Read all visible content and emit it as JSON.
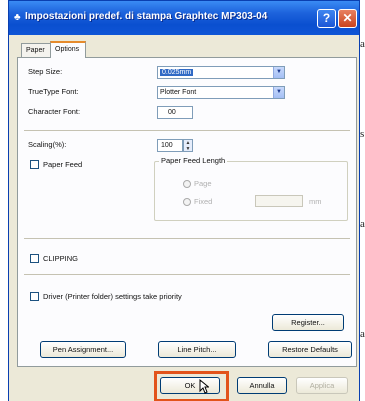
{
  "window": {
    "title": "Impostazioni predef. di stampa Graphtec MP303-04",
    "help_glyph": "?",
    "close_glyph": "✕"
  },
  "tabs": [
    {
      "label": "Paper",
      "active": false
    },
    {
      "label": "Options",
      "active": true
    }
  ],
  "options": {
    "step_size": {
      "label": "Step Size:",
      "value": "0.025mm"
    },
    "truetype_font": {
      "label": "TrueType Font:",
      "value": "Plotter Font"
    },
    "character_font": {
      "label": "Character Font:",
      "value": "00"
    },
    "scaling": {
      "label": "Scaling(%):",
      "value": "100"
    },
    "paper_feed": {
      "label": "Paper Feed",
      "checked": false
    },
    "paper_feed_length": {
      "group_label": "Paper Feed Length",
      "radio1_label": "Page",
      "radio2_label": "Fixed",
      "length_suffix": "mm"
    },
    "clipping": {
      "label": "CLIPPING",
      "checked": false
    },
    "driver_priority": {
      "label": "Driver (Printer folder) settings take priority",
      "checked": false
    }
  },
  "buttons": {
    "register": "Register...",
    "pen_assignment": "Pen Assignment...",
    "line_pitch": "Line Pitch...",
    "restore_defaults": "Restore Defaults",
    "ok": "OK",
    "annulla": "Annulla",
    "applica": "Applica"
  },
  "margin_letters": [
    "a",
    "s",
    "a",
    "a"
  ],
  "colors": {
    "title_bar": "#0a4fd0",
    "highlight": "#e2531b",
    "selection": "#316ac5"
  }
}
